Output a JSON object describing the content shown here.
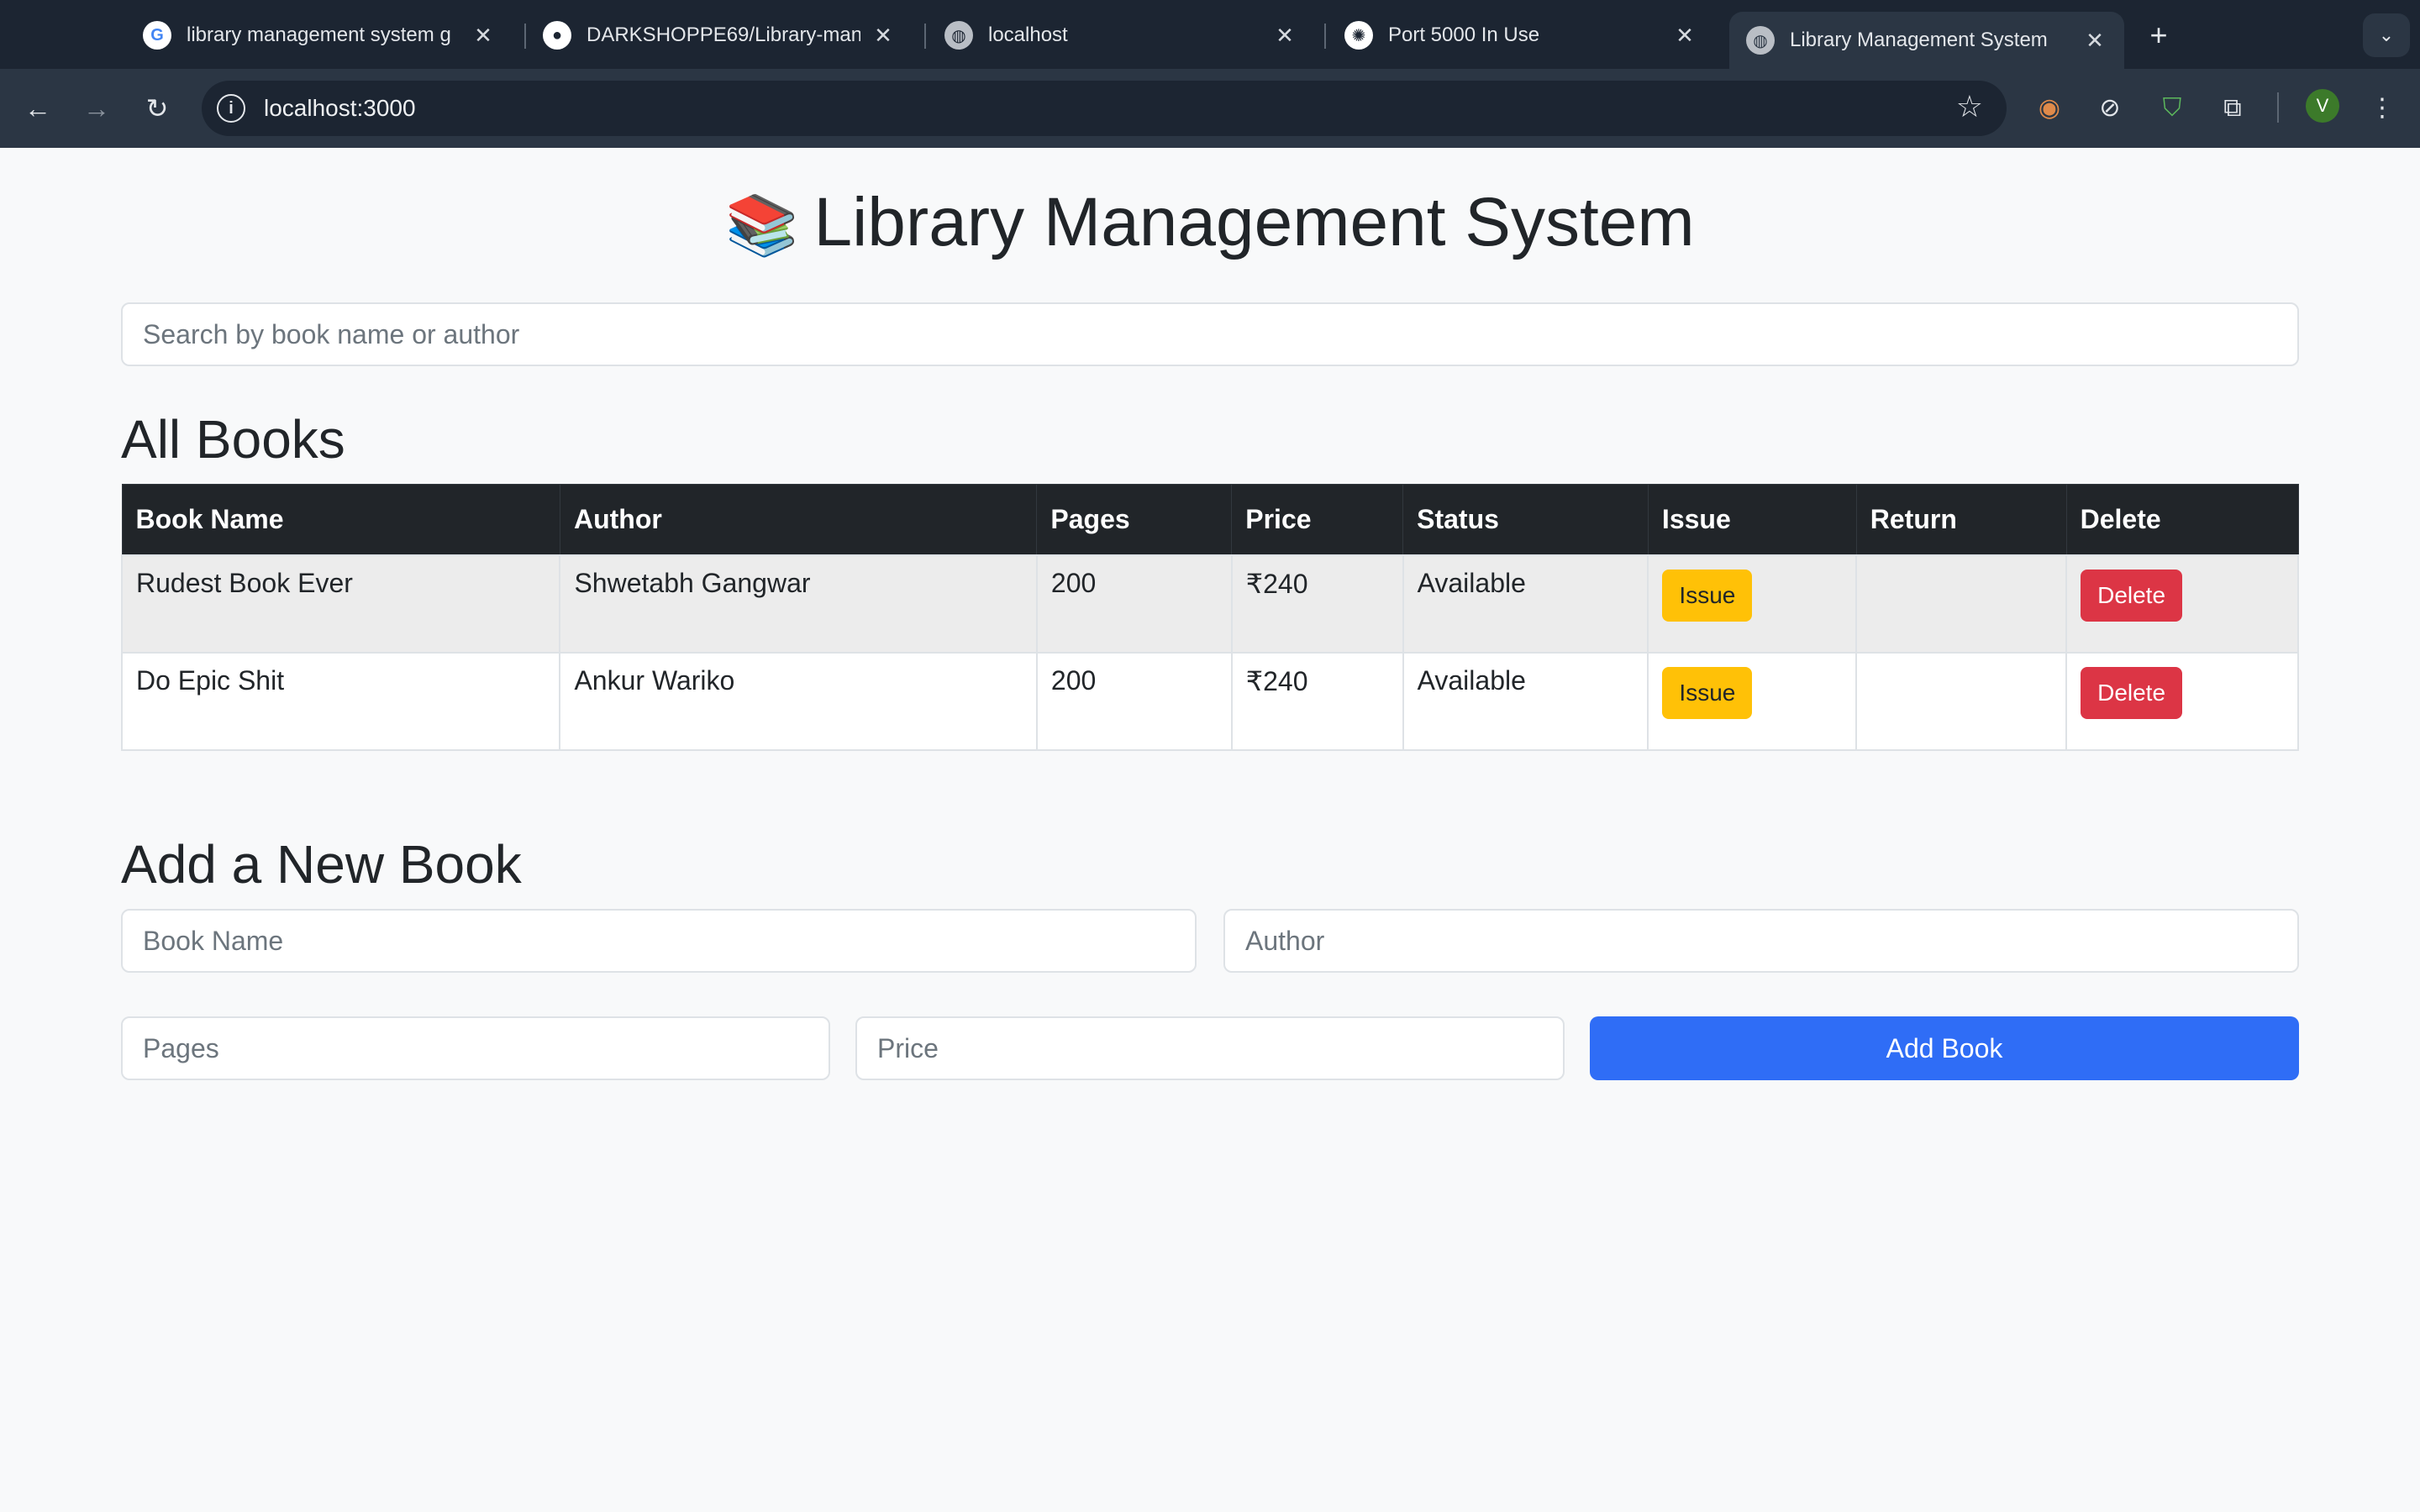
{
  "browser": {
    "tabs": [
      {
        "title": "library management system g",
        "favicon": "google-icon"
      },
      {
        "title": "DARKSHOPPE69/Library-man",
        "favicon": "github-icon"
      },
      {
        "title": "localhost",
        "favicon": "globe-icon"
      },
      {
        "title": "Port 5000 In Use",
        "favicon": "openai-icon"
      },
      {
        "title": "Library Management System",
        "favicon": "globe-icon",
        "active": true
      }
    ],
    "url": "localhost:3000",
    "profile_initial": "V"
  },
  "page": {
    "title": "Library Management System",
    "title_emoji": "📚",
    "search_placeholder": "Search by book name or author",
    "all_books_heading": "All Books",
    "add_heading": "Add a New Book"
  },
  "table": {
    "headers": [
      "Book Name",
      "Author",
      "Pages",
      "Price",
      "Status",
      "Issue",
      "Return",
      "Delete"
    ],
    "rows": [
      {
        "name": "Rudest Book Ever",
        "author": "Shwetabh Gangwar",
        "pages": "200",
        "price": "₹240",
        "status": "Available",
        "issue_label": "Issue",
        "return_label": "",
        "delete_label": "Delete"
      },
      {
        "name": "Do Epic Shit",
        "author": "Ankur Wariko",
        "pages": "200",
        "price": "₹240",
        "status": "Available",
        "issue_label": "Issue",
        "return_label": "",
        "delete_label": "Delete"
      }
    ]
  },
  "form": {
    "book_name_placeholder": "Book Name",
    "author_placeholder": "Author",
    "pages_placeholder": "Pages",
    "price_placeholder": "Price",
    "add_button": "Add Book"
  },
  "colors": {
    "issue": "#ffc107",
    "delete": "#dc3545",
    "primary": "#2f6df6",
    "table_header": "#212529"
  }
}
